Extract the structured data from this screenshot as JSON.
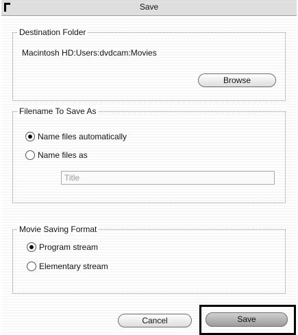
{
  "window": {
    "title": "Save"
  },
  "destination": {
    "legend": "Destination Folder",
    "path": "Macintosh HD:Users:dvdcam:Movies",
    "browse_label": "Browse"
  },
  "filename": {
    "legend": "Filename To Save As",
    "option_auto": "Name files automatically",
    "option_manual": "Name files as",
    "field_placeholder": "Title",
    "selected": "Name files automatically"
  },
  "format": {
    "legend": "Movie Saving Format",
    "option_program": "Program stream",
    "option_elementary": "Elementary stream",
    "selected": "Program stream"
  },
  "actions": {
    "cancel_label": "Cancel",
    "save_label": "Save"
  }
}
